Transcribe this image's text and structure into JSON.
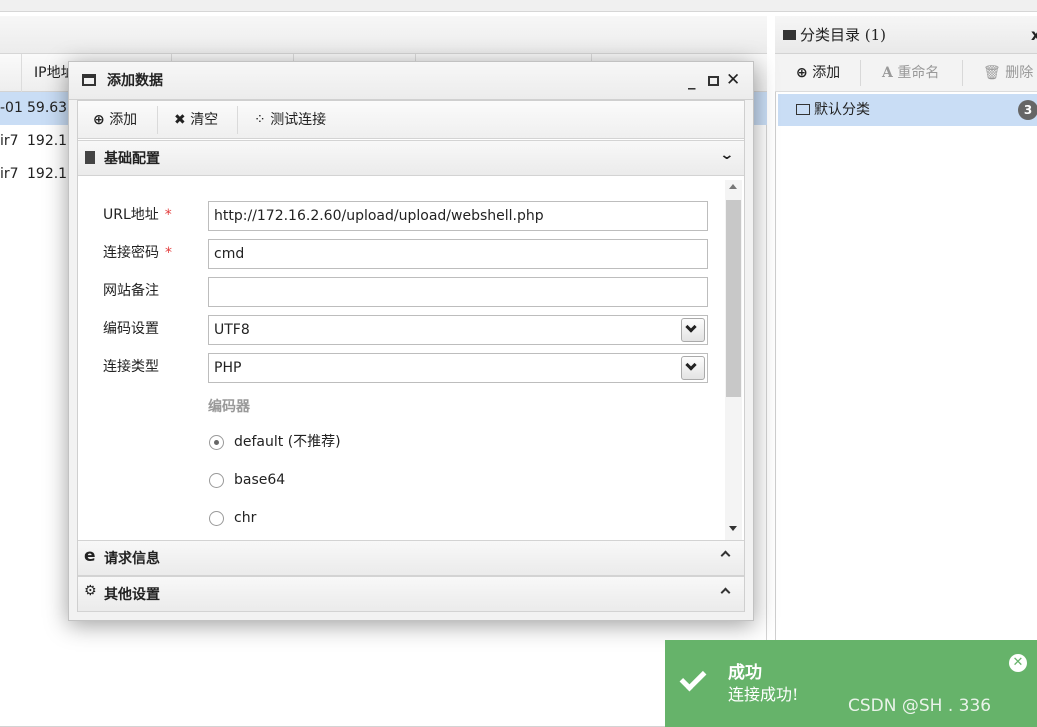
{
  "grid": {
    "header_ip": "IP地址",
    "rows": [
      {
        "col1": "-01",
        "ip": "59.63",
        "selected": true
      },
      {
        "col1": "ir7",
        "ip": "192.1",
        "selected": false
      },
      {
        "col1": "ir7",
        "ip": "192.1",
        "selected": false
      }
    ]
  },
  "category": {
    "title": "分类目录 (1)",
    "toolbar": {
      "add": "添加",
      "rename": "重命名",
      "delete": "删除"
    },
    "items": [
      {
        "label": "默认分类",
        "count": "3"
      }
    ]
  },
  "modal": {
    "title": "添加数据",
    "toolbar": {
      "add": "添加",
      "clear": "清空",
      "test": "测试连接"
    },
    "sections": {
      "basic": "基础配置",
      "request": "请求信息",
      "other": "其他设置"
    },
    "form": {
      "url_label": "URL地址",
      "url_value": "http://172.16.2.60/upload/upload/webshell.php",
      "password_label": "连接密码",
      "password_value": "cmd",
      "note_label": "网站备注",
      "note_value": "",
      "encoding_label": "编码设置",
      "encoding_value": "UTF8",
      "type_label": "连接类型",
      "type_value": "PHP",
      "encoder_label": "编码器",
      "encoders": [
        {
          "label": "default (不推荐)",
          "checked": true
        },
        {
          "label": "base64",
          "checked": false
        },
        {
          "label": "chr",
          "checked": false
        }
      ],
      "required_mark": "*"
    }
  },
  "toast": {
    "title": "成功",
    "message": "连接成功!",
    "color": "#66b36a"
  },
  "watermark": "CSDN @SH    . 336"
}
